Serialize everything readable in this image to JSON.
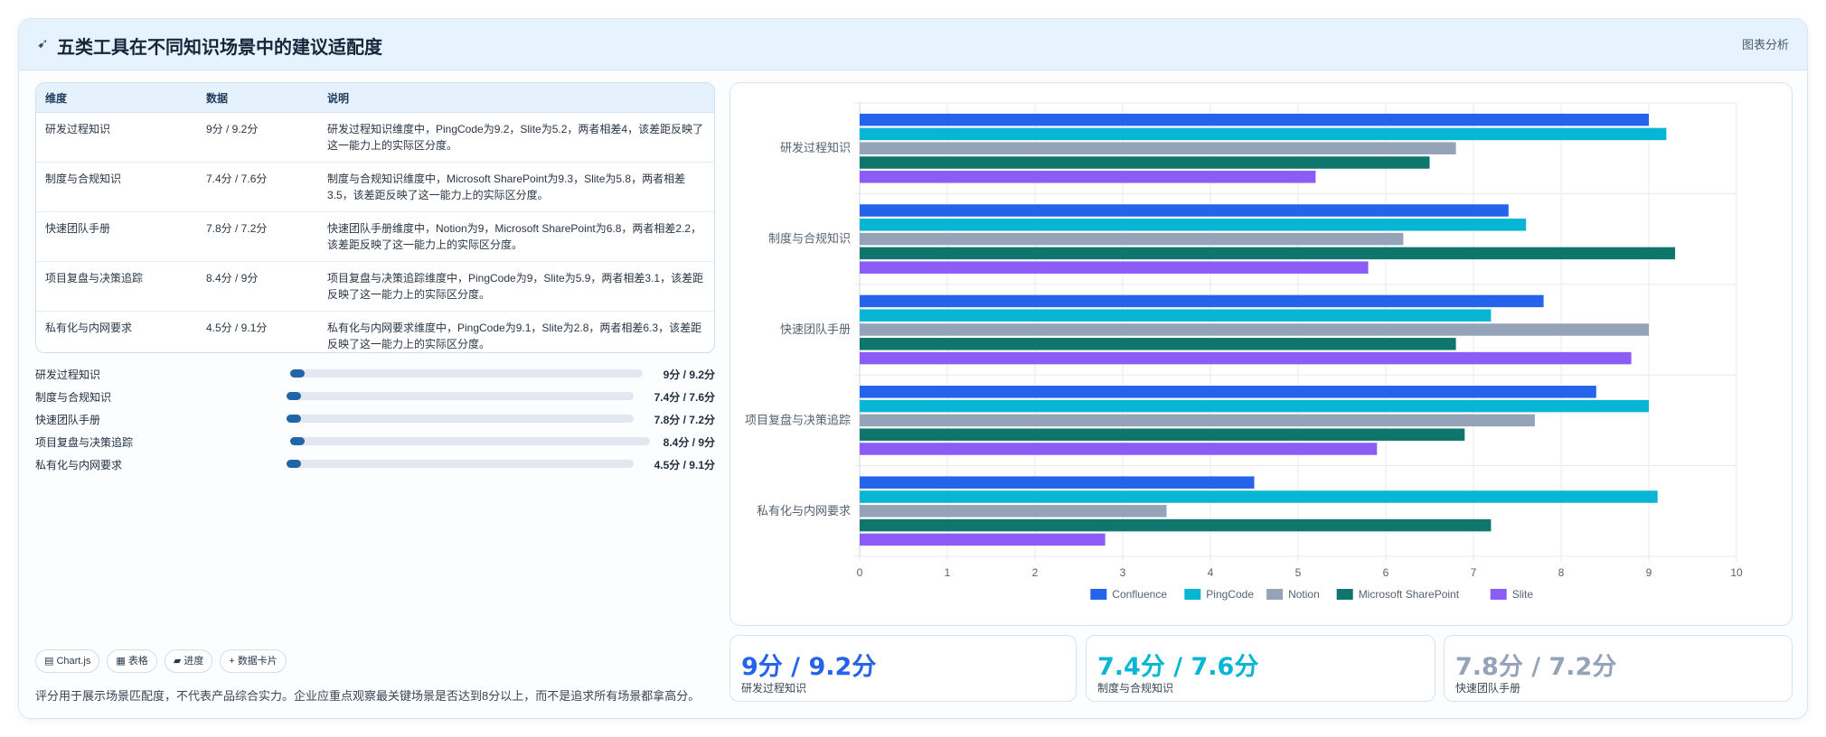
{
  "header": {
    "icon": "rocket-icon",
    "title": "五类工具在不同知识场景中的建议适配度",
    "action": "图表分析"
  },
  "table": {
    "headers": [
      "维度",
      "数据",
      "说明"
    ],
    "rows": [
      {
        "dim": "研发过程知识",
        "data": "9分 / 9.2分",
        "desc": "研发过程知识维度中，PingCode为9.2，Slite为5.2，两者相差4，该差距反映了这一能力上的实际区分度。"
      },
      {
        "dim": "制度与合规知识",
        "data": "7.4分 / 7.6分",
        "desc": "制度与合规知识维度中，Microsoft SharePoint为9.3，Slite为5.8，两者相差3.5，该差距反映了这一能力上的实际区分度。"
      },
      {
        "dim": "快速团队手册",
        "data": "7.8分 / 7.2分",
        "desc": "快速团队手册维度中，Notion为9，Microsoft SharePoint为6.8，两者相差2.2，该差距反映了这一能力上的实际区分度。"
      },
      {
        "dim": "项目复盘与决策追踪",
        "data": "8.4分 / 9分",
        "desc": "项目复盘与决策追踪维度中，PingCode为9，Slite为5.9，两者相差3.1，该差距反映了这一能力上的实际区分度。"
      },
      {
        "dim": "私有化与内网要求",
        "data": "4.5分 / 9.1分",
        "desc": "私有化与内网要求维度中，PingCode为9.1，Slite为2.8，两者相差6.3，该差距反映了这一能力上的实际区分度。"
      }
    ]
  },
  "progress": [
    {
      "label": "研发过程知识",
      "value": "9分 / 9.2分",
      "fill": 0.03
    },
    {
      "label": "制度与合规知识",
      "value": "7.4分 / 7.6分",
      "fill": 0.03
    },
    {
      "label": "快速团队手册",
      "value": "7.8分 / 7.2分",
      "fill": 0.03
    },
    {
      "label": "项目复盘与决策追踪",
      "value": "8.4分 / 9分",
      "fill": 0.03
    },
    {
      "label": "私有化与内网要求",
      "value": "4.5分 / 9.1分",
      "fill": 0.03
    }
  ],
  "chips": [
    {
      "icon": "chart-icon",
      "glyph": "▤",
      "label": "Chart.js"
    },
    {
      "icon": "table-icon",
      "glyph": "▦",
      "label": "表格"
    },
    {
      "icon": "progress-icon",
      "glyph": "▰",
      "label": "进度"
    },
    {
      "icon": "plus-icon",
      "glyph": "+",
      "label": "数据卡片"
    }
  ],
  "footnote": "评分用于展示场景匹配度，不代表产品综合实力。企业应重点观察最关键场景是否达到8分以上，而不是追求所有场景都拿高分。",
  "stats": [
    {
      "value": "9分 / 9.2分",
      "label": "研发过程知识",
      "color": "#2563eb"
    },
    {
      "value": "7.4分 / 7.6分",
      "label": "制度与合规知识",
      "color": "#06b6d4"
    },
    {
      "value": "7.8分 / 7.2分",
      "label": "快速团队手册",
      "color": "#94a3b8"
    }
  ],
  "chart_data": {
    "type": "bar",
    "orientation": "horizontal",
    "categories": [
      "研发过程知识",
      "制度与合规知识",
      "快速团队手册",
      "项目复盘与决策追踪",
      "私有化与内网要求"
    ],
    "series": [
      {
        "name": "Confluence",
        "color": "#2563eb",
        "values": [
          9,
          7.4,
          7.8,
          8.4,
          4.5
        ]
      },
      {
        "name": "PingCode",
        "color": "#06b6d4",
        "values": [
          9.2,
          7.6,
          7.2,
          9,
          9.1
        ]
      },
      {
        "name": "Notion",
        "color": "#94a3b8",
        "values": [
          6.8,
          6.2,
          9,
          7.7,
          3.5
        ]
      },
      {
        "name": "Microsoft SharePoint",
        "color": "#0f766e",
        "values": [
          6.5,
          9.3,
          6.8,
          6.9,
          7.2
        ]
      },
      {
        "name": "Slite",
        "color": "#8b5cf6",
        "values": [
          5.2,
          5.8,
          8.8,
          5.9,
          2.8
        ]
      }
    ],
    "xlim": [
      0,
      10
    ],
    "xticks": [
      0,
      1,
      2,
      3,
      4,
      5,
      6,
      7,
      8,
      9,
      10
    ],
    "grid": true,
    "legend": "bottom"
  }
}
